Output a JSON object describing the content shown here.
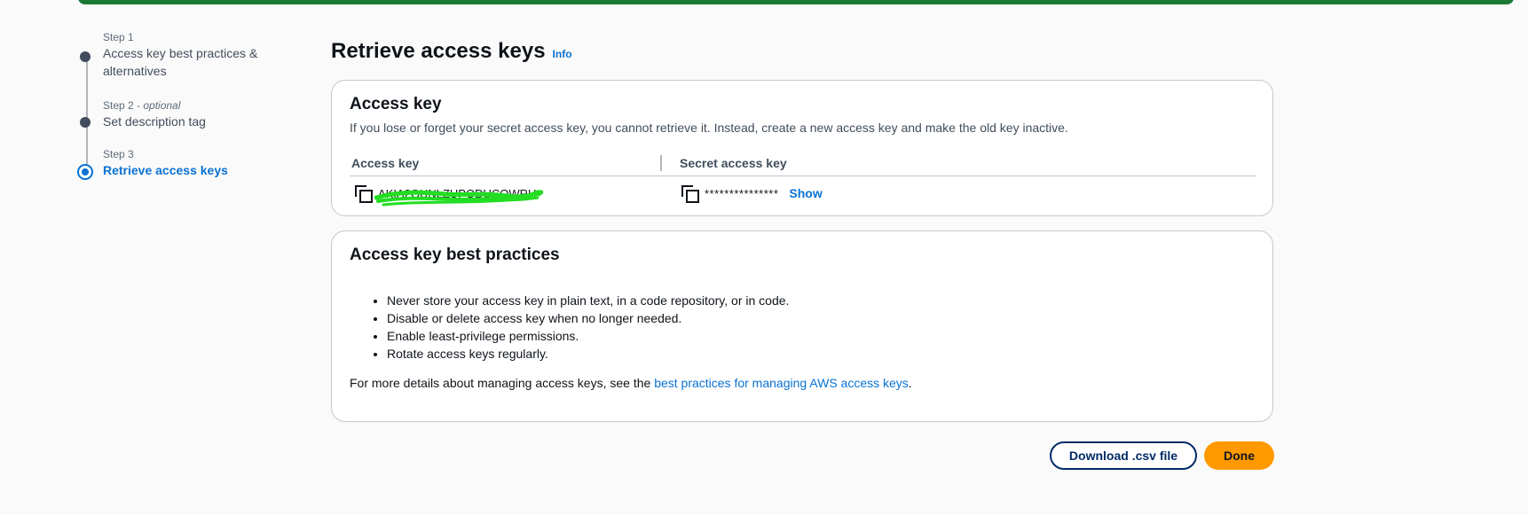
{
  "steps": [
    {
      "num": "Step 1",
      "optional": "",
      "title": "Access key best practices & alternatives"
    },
    {
      "num": "Step 2 - ",
      "optional": "optional",
      "title": "Set description tag"
    },
    {
      "num": "Step 3",
      "optional": "",
      "title": "Retrieve access keys"
    }
  ],
  "page": {
    "title": "Retrieve access keys",
    "info": "Info"
  },
  "access_key_card": {
    "title": "Access key",
    "description": "If you lose or forget your secret access key, you cannot retrieve it. Instead, create a new access key and make the old key inactive.",
    "col_access_key": "Access key",
    "col_secret_key": "Secret access key",
    "access_key_value": "AKIA2GUNLZUPODUCOWRH",
    "secret_key_masked": "***************",
    "show_label": "Show"
  },
  "best_practices_card": {
    "title": "Access key best practices",
    "items": [
      "Never store your access key in plain text, in a code repository, or in code.",
      "Disable or delete access key when no longer needed.",
      "Enable least-privilege permissions.",
      "Rotate access keys regularly."
    ],
    "footer_prefix": "For more details about managing access keys, see the ",
    "footer_link": "best practices for managing AWS access keys",
    "footer_suffix": "."
  },
  "actions": {
    "download_label": "Download .csv file",
    "done_label": "Done"
  },
  "colors": {
    "accent": "#0972d3",
    "primary_button": "#ff9900",
    "banner": "#1a7a33",
    "redaction": "#22dd22"
  }
}
